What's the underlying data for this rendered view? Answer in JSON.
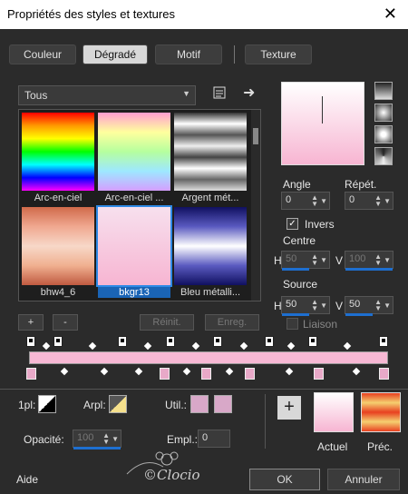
{
  "window": {
    "title": "Propriétés des styles et textures"
  },
  "tabs": [
    {
      "label": "Couleur"
    },
    {
      "label": "Dégradé"
    },
    {
      "label": "Motif"
    },
    {
      "label": "Texture"
    }
  ],
  "category": {
    "selected": "Tous"
  },
  "gradients": [
    {
      "label": "Arc-en-ciel"
    },
    {
      "label": "Arc-en-ciel ..."
    },
    {
      "label": "Argent mét..."
    },
    {
      "label": "bhw4_6"
    },
    {
      "label": "bkgr13"
    },
    {
      "label": "Bleu métalli..."
    }
  ],
  "editor": {
    "add": "+",
    "remove": "-",
    "reset": "Réinit.",
    "save": "Enreg."
  },
  "params": {
    "angle_label": "Angle",
    "angle_value": "0",
    "repeat_label": "Répét.",
    "repeat_value": "0",
    "invert_label": "Invers",
    "center_label": "Centre",
    "center_h_label": "H",
    "center_h": "50",
    "center_v_label": "V",
    "center_v": "100",
    "source_label": "Source",
    "source_h_label": "H",
    "source_h": "50",
    "source_v_label": "V",
    "source_v": "50",
    "link_label": "Liaison"
  },
  "bottom": {
    "first_plan_label": "1pl:",
    "arrplan_label": "Arpl:",
    "util_label": "Util.:",
    "opacity_label": "Opacité:",
    "opacity_value": "100",
    "empl_label": "Empl.:",
    "empl_value": "0",
    "current_label": "Actuel",
    "previous_label": "Préc."
  },
  "footer": {
    "help": "Aide",
    "ok": "OK",
    "cancel": "Annuler",
    "watermark": "©Clocio"
  },
  "colors": {
    "accent": "#1e6fd0",
    "pink": "#f7b5d2",
    "stop_pink": "#e8a9c8"
  }
}
